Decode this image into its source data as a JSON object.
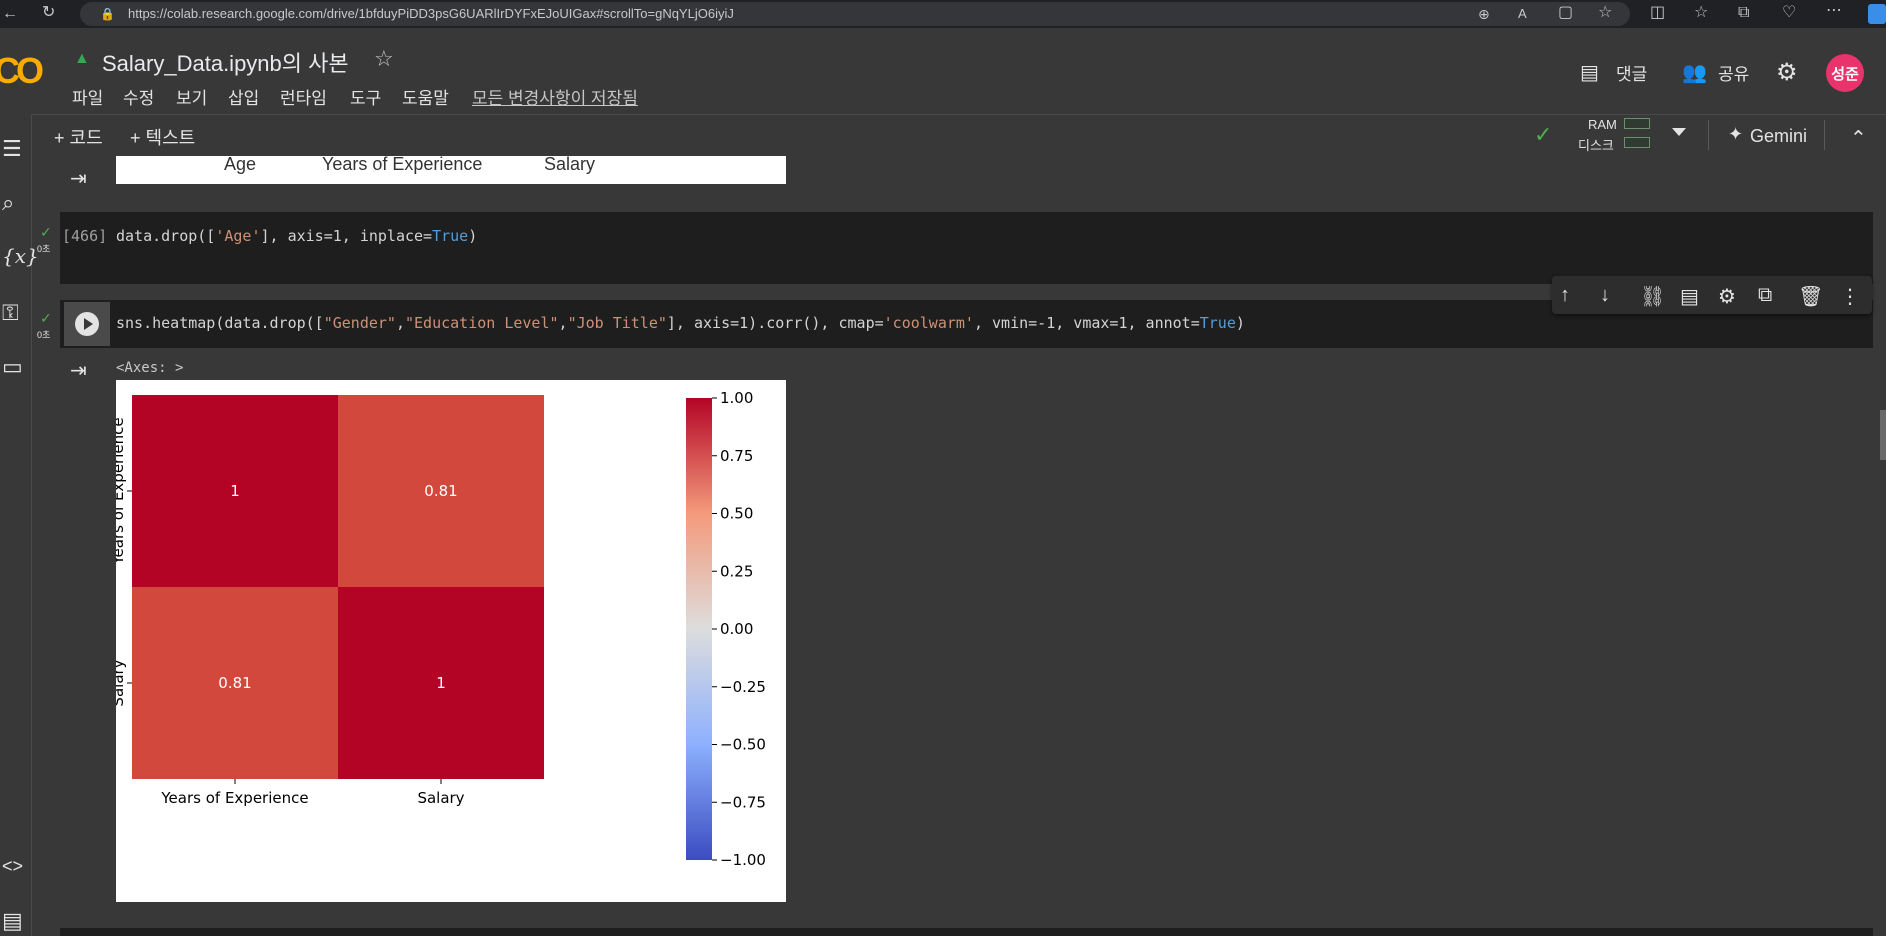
{
  "browser": {
    "url": "https://colab.research.google.com/drive/1bfduyPiDD3psG6UARlIrDYFxEJoUIGax#scrollTo=gNqYLjO6iyiJ"
  },
  "header": {
    "title": "Salary_Data.ipynb의 사본",
    "menu": [
      "파일",
      "수정",
      "보기",
      "삽입",
      "런타임",
      "도구",
      "도움말"
    ],
    "saved_status": "모든 변경사항이 저장됨",
    "comment_label": "댓글",
    "share_label": "공유",
    "avatar_text": "성준"
  },
  "toolbar": {
    "add_code": "+ 코드",
    "add_text": "+ 텍스트",
    "ram_label": "RAM",
    "disk_label": "디스크",
    "gemini_label": "Gemini"
  },
  "previous_output": {
    "headers": [
      "Age",
      "Years of Experience",
      "Salary"
    ]
  },
  "cells": [
    {
      "exec_count": "[466]",
      "time": "0초",
      "code_parts": [
        "data.drop([",
        "'Age'",
        "], axis=1, inplace=",
        "True",
        ")"
      ]
    },
    {
      "time": "0초",
      "code_parts": [
        "sns.heatmap(data.drop([",
        "\"Gender\"",
        ",",
        "\"Education Level\"",
        ",",
        "\"Job Title\"",
        "], axis=1).corr(), cmap=",
        "'coolwarm'",
        ", vmin=-1, vmax=1, annot=",
        "True",
        ")"
      ],
      "output_text": "<Axes: >"
    }
  ],
  "chart_data": {
    "type": "heatmap",
    "x_labels": [
      "Years of Experience",
      "Salary"
    ],
    "y_labels": [
      "Years of Experience",
      "Salary"
    ],
    "values": [
      [
        1,
        0.81
      ],
      [
        0.81,
        1
      ]
    ],
    "annotations": [
      [
        "1",
        "0.81"
      ],
      [
        "0.81",
        "1"
      ]
    ],
    "cmap": "coolwarm",
    "vmin": -1,
    "vmax": 1,
    "colorbar_ticks": [
      "1.00",
      "0.75",
      "0.50",
      "0.25",
      "0.00",
      "−0.25",
      "−0.50",
      "−0.75",
      "−1.00"
    ],
    "colorbar_tick_values": [
      1,
      0.75,
      0.5,
      0.25,
      0,
      -0.25,
      -0.5,
      -0.75,
      -1
    ]
  }
}
